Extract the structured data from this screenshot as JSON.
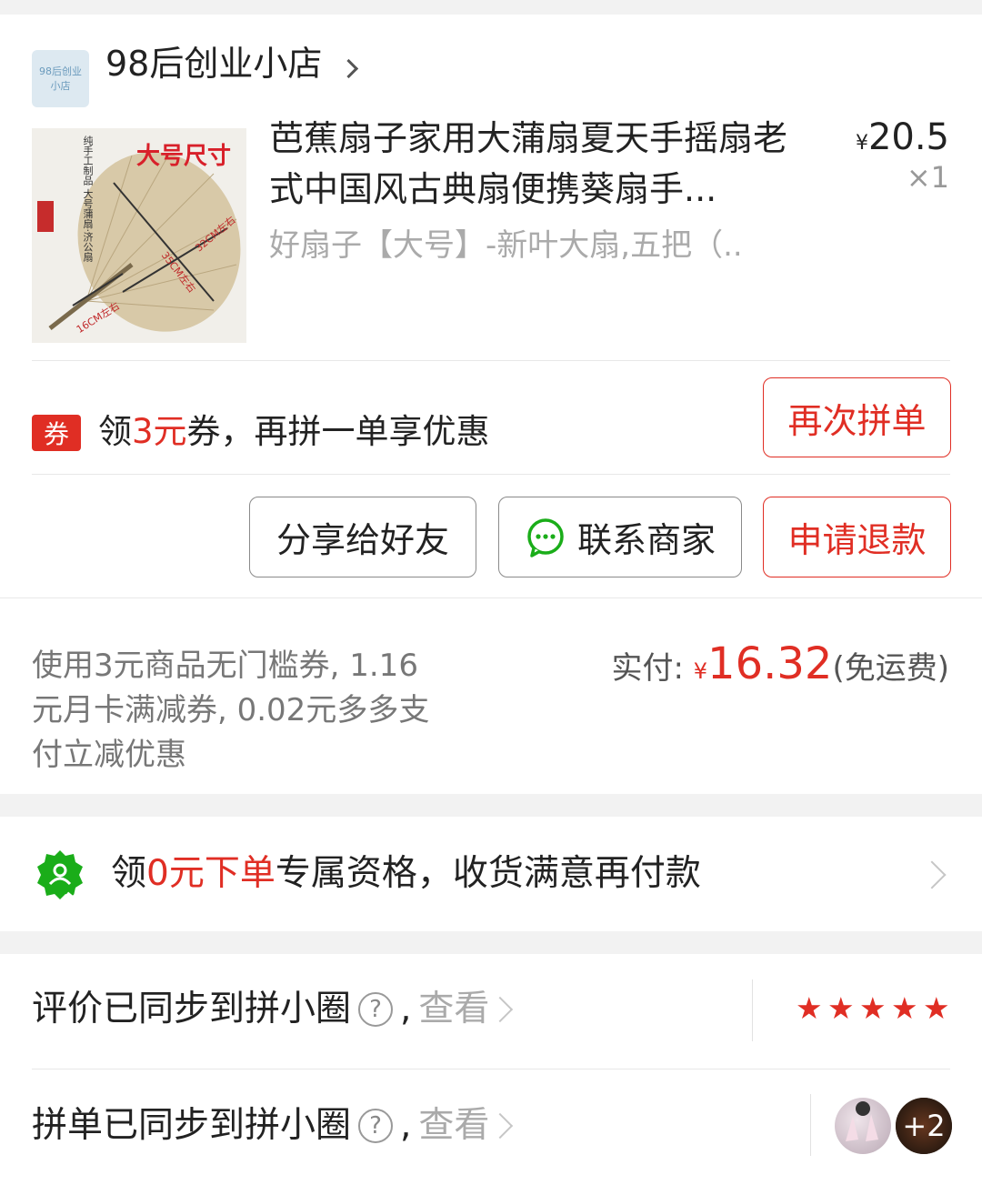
{
  "shop": {
    "logo_text": "98后创业小店",
    "name": "98后创业小店"
  },
  "product": {
    "title": "芭蕉扇子家用大蒲扇夏天手摇扇老式中国风古典扇便携葵扇手...",
    "spec": "好扇子【大号】-新叶大扇,五把（...",
    "price_symbol": "¥",
    "price": "20.5",
    "quantity": "×1",
    "image_texts": {
      "size_title": "大号尺寸",
      "dim1": "32CM左右",
      "dim2": "35CM左右",
      "dim3": "16CM左右",
      "caption": "纯手工制品 大号蒲扇·济公扇"
    }
  },
  "coupon": {
    "tag": "券",
    "prefix": "领",
    "amount": "3元",
    "suffix": "券，再拼一单享优惠",
    "action": "再次拼单"
  },
  "actions": {
    "share": "分享给好友",
    "contact": "联系商家",
    "refund": "申请退款"
  },
  "payment": {
    "summary": "使用3元商品无门槛券, 1.16元月卡满减券, 0.02元多多支付立减优惠",
    "paid_label": "实付: ",
    "currency": "¥",
    "amount": "16.32",
    "shipping": "(免运费)"
  },
  "free_order": {
    "prefix": "领",
    "highlight": "0元下单",
    "suffix": "专属资格，收货满意再付款"
  },
  "review_sync": {
    "label": "评价已同步到拼小圈",
    "help": "?",
    "sep": ",",
    "view": "查看",
    "stars": 5
  },
  "group_sync": {
    "label": "拼单已同步到拼小圈",
    "help": "?",
    "sep": ",",
    "view": "查看",
    "extra_count": "+2"
  },
  "colors": {
    "accent": "#e02e24",
    "green": "#1aad19"
  }
}
